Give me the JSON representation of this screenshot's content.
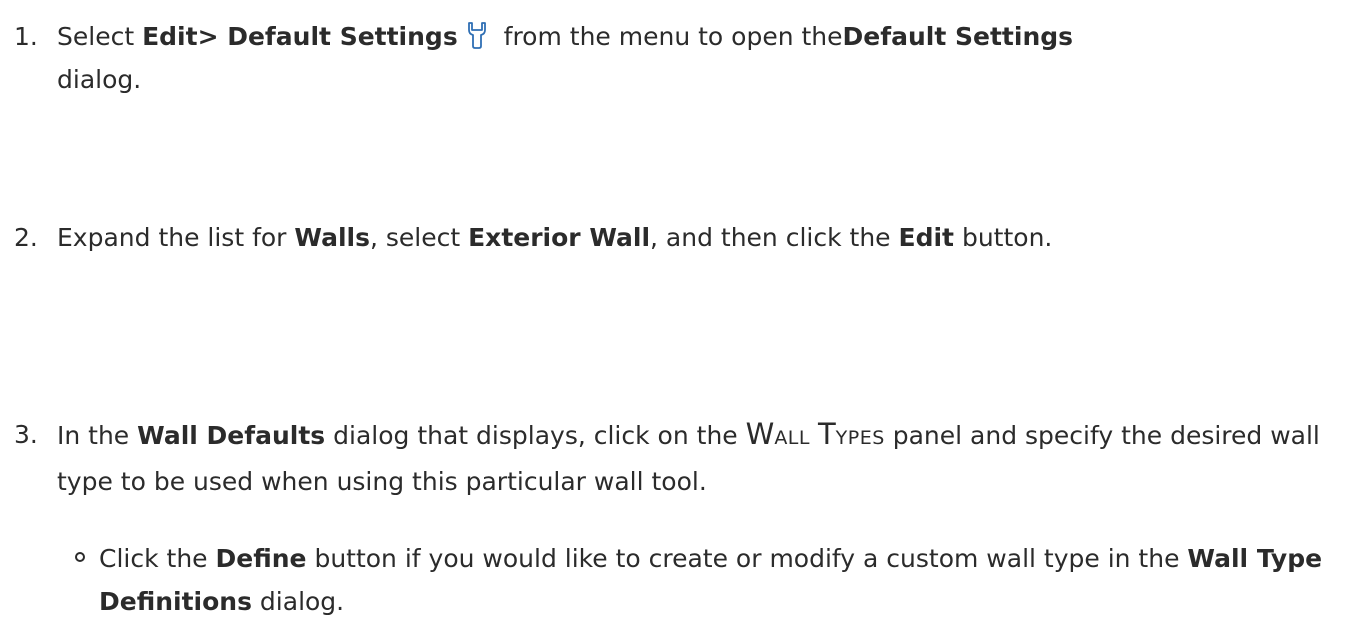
{
  "steps": [
    {
      "num": "1.",
      "t1": "Select ",
      "b1": "Edit> Default Settings",
      "t2": " from the menu to open the",
      "b2": "Default Settings",
      "t3": " dialog.",
      "icon": "wrench-icon"
    },
    {
      "num": "2.",
      "t1": "Expand the list for ",
      "b1": "Walls",
      "t2": ", select ",
      "b2": "Exterior Wall",
      "t3": ", and then click the ",
      "b3": "Edit",
      "t4": " button."
    },
    {
      "num": "3.",
      "t1": "In the ",
      "b1": "Wall Defaults",
      "t2": " dialog that displays, click on the ",
      "sc1_big": "W",
      "sc1_small": "ALL",
      "sc2_big": "T",
      "sc2_small": "YPES",
      "t3": " panel and specify the desired wall type to be used when using this particular wall tool."
    }
  ],
  "sub": {
    "t1": "Click the ",
    "b1": "Define",
    "t2": " button if you would like to create or modify a custom wall type in the ",
    "b2": "Wall Type Definitions",
    "t3": " dialog."
  },
  "colors": {
    "text": "#2b2b2b",
    "icon": "#2f6fb4"
  }
}
